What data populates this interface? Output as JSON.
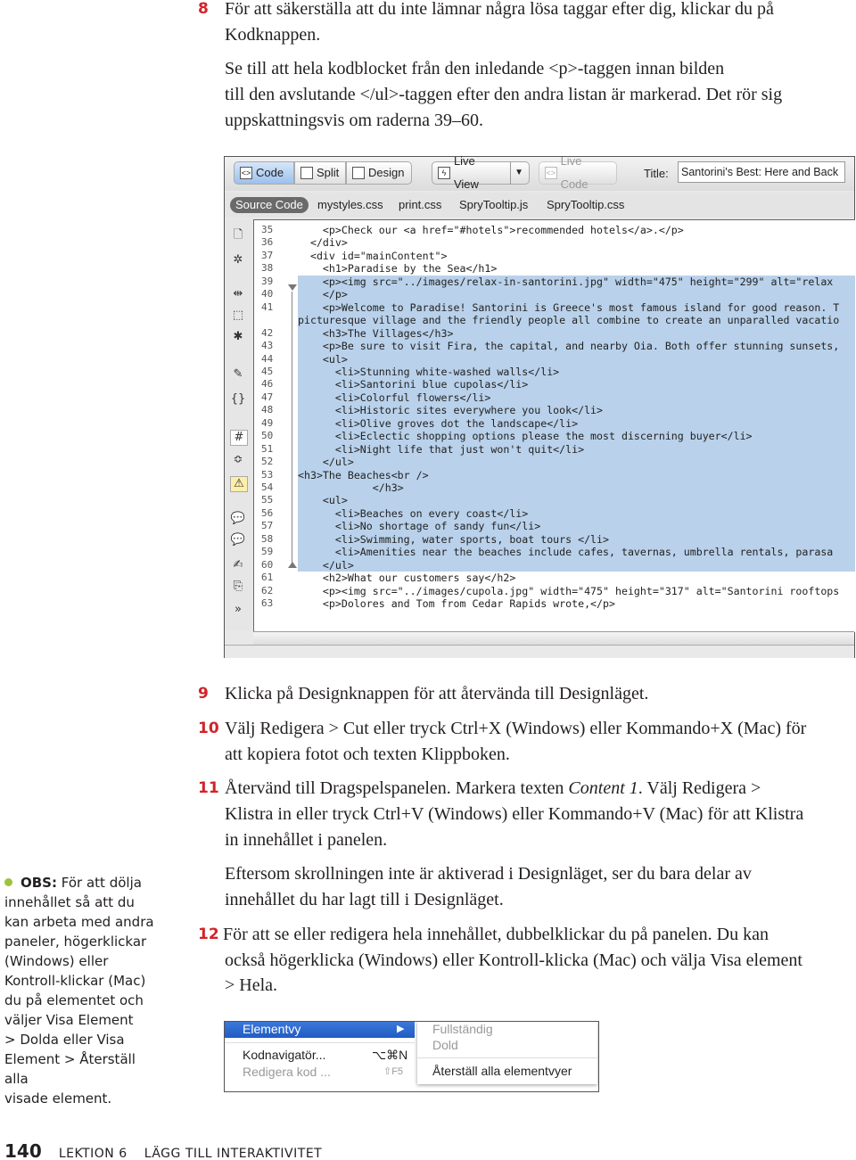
{
  "steps_top": {
    "s8": {
      "num": "8",
      "lines": [
        "För att säkerställa att du inte lämnar några lösa taggar efter dig, klickar du på",
        "Kodknappen."
      ]
    },
    "p8": {
      "lines": [
        "Se till att hela kodblocket från den inledande <p>-taggen innan bilden",
        "till den avslutande </ul>-taggen efter den andra listan är markerad. Det rör sig",
        "uppskattningsvis om raderna 39–60."
      ]
    }
  },
  "editor": {
    "toolbar": {
      "code": "Code",
      "split": "Split",
      "design": "Design",
      "live_view": "Live View",
      "live_code": "Live Code",
      "title_label": "Title:",
      "title_value": "Santorini's Best: Here and Back"
    },
    "related_files": [
      "Source Code",
      "mystyles.css",
      "print.css",
      "SpryTooltip.js",
      "SpryTooltip.css"
    ],
    "code_lines": [
      {
        "n": "35",
        "t": "    <p>Check our <a href=\"#hotels\">recommended hotels</a>.</p>",
        "sel": false
      },
      {
        "n": "36",
        "t": "  </div>",
        "sel": false
      },
      {
        "n": "37",
        "t": "  <div id=\"mainContent\">",
        "sel": false
      },
      {
        "n": "38",
        "t": "    <h1>Paradise by the Sea</h1>",
        "sel": false
      },
      {
        "n": "39",
        "t": "    <p><img src=\"../images/relax-in-santorini.jpg\" width=\"475\" height=\"299\" alt=\"relax",
        "sel": true
      },
      {
        "n": "40",
        "t": "    </p>",
        "sel": true
      },
      {
        "n": "41",
        "t": "    <p>Welcome to Paradise! Santorini is Greece's most famous island for good reason. T",
        "sel": true
      },
      {
        "n": "",
        "t": "picturesque village and the friendly people all combine to create an unparalled vacatio",
        "sel": true
      },
      {
        "n": "42",
        "t": "    <h3>The Villages</h3>",
        "sel": true
      },
      {
        "n": "43",
        "t": "    <p>Be sure to visit Fira, the capital, and nearby Oia. Both offer stunning sunsets,",
        "sel": true
      },
      {
        "n": "44",
        "t": "    <ul>",
        "sel": true
      },
      {
        "n": "45",
        "t": "      <li>Stunning white-washed walls</li>",
        "sel": true
      },
      {
        "n": "46",
        "t": "      <li>Santorini blue cupolas</li>",
        "sel": true
      },
      {
        "n": "47",
        "t": "      <li>Colorful flowers</li>",
        "sel": true
      },
      {
        "n": "48",
        "t": "      <li>Historic sites everywhere you look</li>",
        "sel": true
      },
      {
        "n": "49",
        "t": "      <li>Olive groves dot the landscape</li>",
        "sel": true
      },
      {
        "n": "50",
        "t": "      <li>Eclectic shopping options please the most discerning buyer</li>",
        "sel": true
      },
      {
        "n": "51",
        "t": "      <li>Night life that just won't quit</li>",
        "sel": true
      },
      {
        "n": "52",
        "t": "    </ul>",
        "sel": true
      },
      {
        "n": "53",
        "t": "<h3>The Beaches<br />",
        "sel": true
      },
      {
        "n": "54",
        "t": "            </h3>",
        "sel": true
      },
      {
        "n": "55",
        "t": "    <ul>",
        "sel": true
      },
      {
        "n": "56",
        "t": "      <li>Beaches on every coast</li>",
        "sel": true
      },
      {
        "n": "57",
        "t": "      <li>No shortage of sandy fun</li>",
        "sel": true
      },
      {
        "n": "58",
        "t": "      <li>Swimming, water sports, boat tours </li>",
        "sel": true
      },
      {
        "n": "59",
        "t": "      <li>Amenities near the beaches include cafes, tavernas, umbrella rentals, parasa",
        "sel": true
      },
      {
        "n": "60",
        "t": "    </ul>",
        "sel": true
      },
      {
        "n": "61",
        "t": "    <h2>What our customers say</h2>",
        "sel": false
      },
      {
        "n": "62",
        "t": "    <p><img src=\"../images/cupola.jpg\" width=\"475\" height=\"317\" alt=\"Santorini rooftops",
        "sel": false
      },
      {
        "n": "63",
        "t": "    <p>Dolores and Tom from Cedar Rapids wrote,</p>",
        "sel": false
      }
    ],
    "selection_color": "#b9d1ea"
  },
  "steps_bottom": {
    "s9": {
      "num": "9",
      "lines": [
        "Klicka på Designknappen för att återvända till Designläget."
      ]
    },
    "s10": {
      "num": "10",
      "lines": [
        "Välj Redigera > Cut eller tryck Ctrl+X (Windows) eller Kommando+X (Mac) för",
        "att kopiera fotot och texten Klippboken."
      ]
    },
    "s11": {
      "num": "11",
      "l1a": "Återvänd till Dragspelspanelen. Markera texten ",
      "l1b": "Content 1",
      "l1c": ". Välj Redigera >",
      "lines": [
        "Klistra in eller tryck Ctrl+V (Windows) eller Kommando+V (Mac) för att Klistra",
        "in innehållet i panelen."
      ]
    },
    "p11": {
      "lines": [
        "Eftersom skrollningen inte är aktiverad i Designläget, ser du bara delar av",
        "innehållet du har lagt till i Designläget."
      ]
    },
    "s12": {
      "num": "12",
      "lines": [
        "För att se eller redigera hela innehållet, dubbelklickar du på panelen. Du kan",
        "också högerklicka (Windows) eller Kontroll-klicka (Mac) och välja Visa element",
        "> Hela."
      ]
    }
  },
  "menu": {
    "selected": "Elementvy",
    "items": [
      {
        "label": "Kodnavigatör...",
        "shortcut": "⌥⌘N"
      },
      {
        "label": "Redigera kod ...",
        "shortcut": "⇧F5"
      }
    ],
    "submenu": [
      "Fullständig",
      "Dold",
      "Återställ alla elementvyer"
    ]
  },
  "note": {
    "label": "OBS:",
    "lines": [
      " För att dölja",
      "innehållet så att du",
      "kan arbeta med andra",
      "paneler, högerklickar",
      "(Windows) eller",
      "Kontroll-klickar (Mac)",
      "du på elementet och",
      "väljer Visa Element",
      "> Dolda eller Visa",
      "Element > Återställ alla",
      "visade element."
    ],
    "dot_color": "#9ac43c"
  },
  "footer": {
    "page": "140",
    "lesson": "LEKTION 6",
    "chapter": "LÄGG TILL INTERAKTIVITET"
  },
  "colors": {
    "step_number": "#d2232a"
  }
}
